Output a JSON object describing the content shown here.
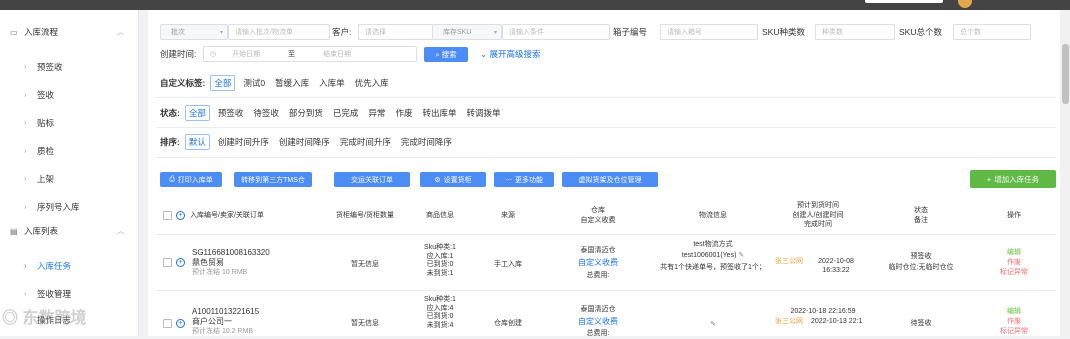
{
  "sidebar": {
    "groups": [
      {
        "label": "入库流程",
        "items": [
          "预签收",
          "签收",
          "贴标",
          "质检",
          "上架",
          "序列号入库"
        ]
      },
      {
        "label": "入库列表",
        "items": [
          "入库任务",
          "签收管理",
          "操作日志"
        ]
      }
    ]
  },
  "search": {
    "batch_select": "批次",
    "batch_placeholder": "请输入批次/物流单",
    "customer_label": "客户:",
    "customer_placeholder": "请选择",
    "sku_select": "库存SKU",
    "sku_placeholder": "请输入条件",
    "box_label": "箱子编号",
    "box_placeholder": "请输入箱号",
    "sku_types_label": "SKU种类数",
    "sku_types_placeholder": "种类数",
    "sku_total_label": "SKU总个数",
    "sku_total_placeholder": "总个数",
    "created_label": "创建时间:",
    "start_placeholder": "开始日期",
    "to": "至",
    "end_placeholder": "结束日期",
    "search_button": "搜索",
    "advanced": "展开高级搜索"
  },
  "filters": {
    "custom_tags": {
      "title": "自定义标签:",
      "options": [
        "全部",
        "测试0",
        "暂缓入库",
        "入库单",
        "优先入库"
      ],
      "selected": 0
    },
    "status": {
      "title": "状态:",
      "options": [
        "全部",
        "预签收",
        "待签收",
        "部分到货",
        "已完成",
        "异常",
        "作废",
        "转出库单",
        "转调拨单"
      ],
      "selected": 0
    },
    "sort": {
      "title": "排序:",
      "options": [
        "默认",
        "创建时间升序",
        "创建时间降序",
        "完成时间升序",
        "完成时间降序"
      ],
      "selected": 0
    }
  },
  "actions": {
    "buttons": [
      "打印入库单",
      "转移到第三方TMS仓",
      "交运关联订单",
      "设置货柜",
      "更多功能",
      "虚拟货架及仓位管理"
    ],
    "add": "增加入库任务"
  },
  "table": {
    "headers": {
      "order": "入库编号/卖家/关联订单",
      "container": "货柜编号/货柜数量",
      "goods": "商品信息",
      "source": "来源",
      "warehouse": [
        "仓库",
        "自定义收费"
      ],
      "logistics": "物流信息",
      "times": [
        "预计到货时间",
        "创建人/创建时间",
        "完成时间"
      ],
      "state": [
        "状态",
        "备注"
      ],
      "op": "操作"
    },
    "rows": [
      {
        "order_no": "SG116681008163320",
        "seller": "鼎色贸易",
        "freeze": "预计冻结 10 RMB",
        "container": "暂无信息",
        "goods": [
          "Sku种类:1",
          "应入库:1",
          "已到货:0",
          "未到货:1"
        ],
        "source": "手工入库",
        "warehouse": "泰国清迈仓",
        "custom_fee": "自定义收费",
        "total_fee": "总费用:",
        "logistics": [
          "test物流方式",
          "test1006001(Yes)",
          "共有1个快递单号，预签收了1个；"
        ],
        "creator": "张三公网",
        "created_at": "2022-10-08 16:33:22",
        "status": "预签收",
        "remark": "临时仓位:无临时仓位",
        "ops": [
          "编辑",
          "作废",
          "标记异常"
        ]
      },
      {
        "order_no": "A10011013221615",
        "seller": "商户公司一",
        "freeze": "预计冻结 10.2 RMB",
        "container": "暂无信息",
        "goods": [
          "Sku种类:1",
          "应入库:4",
          "已到货:0",
          "未到货:4"
        ],
        "source": "仓库创建",
        "warehouse": "泰国清迈仓",
        "custom_fee": "自定义收费",
        "total_fee": "总费用:",
        "logistics": [],
        "eta": "2022-10-18 22:16:59",
        "creator": "张三公网",
        "created_at": "2022-10-13 22:1",
        "status": "待签收",
        "remark": "",
        "ops": [
          "编辑",
          "作废",
          "标记异常"
        ]
      }
    ]
  },
  "watermark": "东数跨境",
  "colors": {
    "accent": "#1a73e8",
    "primary_button": "#4c8cf5",
    "add_button": "#5fb944",
    "creator": "#e6a23c",
    "danger": "#f56c6c",
    "success": "#67c23a"
  }
}
